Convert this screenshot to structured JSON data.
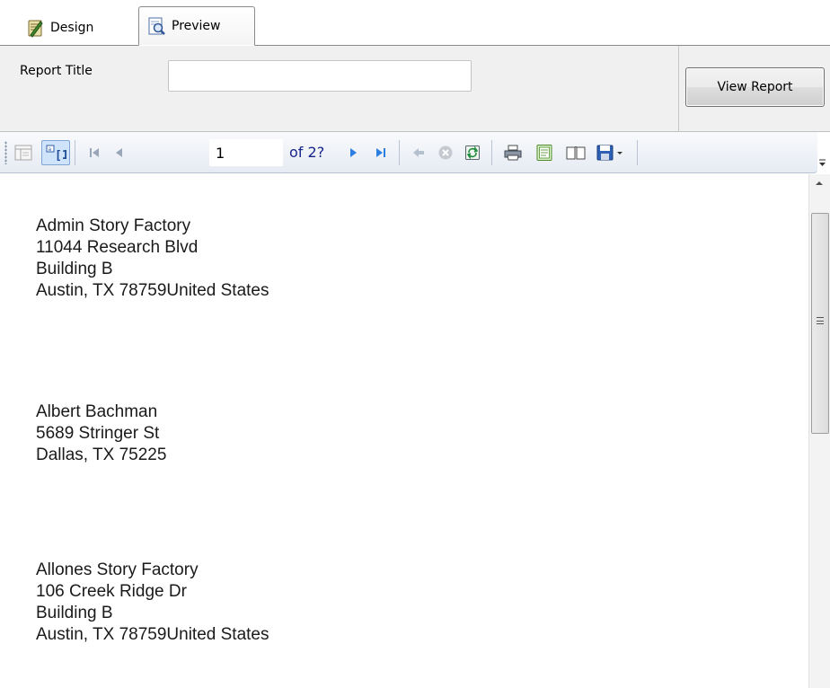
{
  "tabs": [
    {
      "label": "Design",
      "icon": "design-icon"
    },
    {
      "label": "Preview",
      "icon": "preview-icon"
    }
  ],
  "parameters": {
    "report_title_label": "Report Title",
    "report_title_value": "",
    "view_report_label": "View Report"
  },
  "toolbar": {
    "current_page": "1",
    "page_count_text": "of 2?",
    "icons": [
      "document-map-icon",
      "parameters-toggle-icon",
      "first-page-icon",
      "previous-page-icon",
      "next-page-icon",
      "last-page-icon",
      "back-icon",
      "stop-icon",
      "refresh-icon",
      "print-icon",
      "print-layout-icon",
      "page-setup-icon",
      "export-icon"
    ]
  },
  "report": {
    "addresses": [
      {
        "lines": [
          "Admin Story Factory",
          "11044 Research Blvd",
          "Building B",
          "Austin, TX  78759United States"
        ]
      },
      {
        "lines": [
          "Albert Bachman",
          "5689 Stringer St",
          "Dallas, TX  75225"
        ]
      },
      {
        "lines": [
          "Allones Story Factory",
          "106 Creek Ridge Dr",
          "Building B",
          "Austin, TX  78759United States"
        ]
      }
    ]
  }
}
